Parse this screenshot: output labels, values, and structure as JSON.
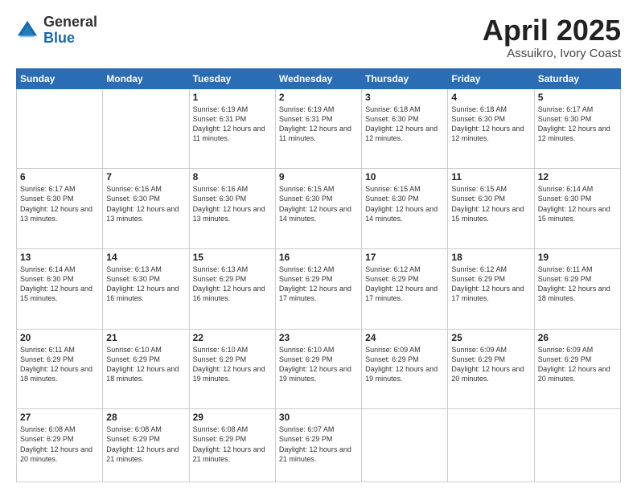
{
  "header": {
    "logo_general": "General",
    "logo_blue": "Blue",
    "title": "April 2025",
    "location": "Assuikro, Ivory Coast"
  },
  "weekdays": [
    "Sunday",
    "Monday",
    "Tuesday",
    "Wednesday",
    "Thursday",
    "Friday",
    "Saturday"
  ],
  "weeks": [
    [
      {
        "day": "",
        "info": ""
      },
      {
        "day": "",
        "info": ""
      },
      {
        "day": "1",
        "info": "Sunrise: 6:19 AM\nSunset: 6:31 PM\nDaylight: 12 hours and 11 minutes."
      },
      {
        "day": "2",
        "info": "Sunrise: 6:19 AM\nSunset: 6:31 PM\nDaylight: 12 hours and 11 minutes."
      },
      {
        "day": "3",
        "info": "Sunrise: 6:18 AM\nSunset: 6:30 PM\nDaylight: 12 hours and 12 minutes."
      },
      {
        "day": "4",
        "info": "Sunrise: 6:18 AM\nSunset: 6:30 PM\nDaylight: 12 hours and 12 minutes."
      },
      {
        "day": "5",
        "info": "Sunrise: 6:17 AM\nSunset: 6:30 PM\nDaylight: 12 hours and 12 minutes."
      }
    ],
    [
      {
        "day": "6",
        "info": "Sunrise: 6:17 AM\nSunset: 6:30 PM\nDaylight: 12 hours and 13 minutes."
      },
      {
        "day": "7",
        "info": "Sunrise: 6:16 AM\nSunset: 6:30 PM\nDaylight: 12 hours and 13 minutes."
      },
      {
        "day": "8",
        "info": "Sunrise: 6:16 AM\nSunset: 6:30 PM\nDaylight: 12 hours and 13 minutes."
      },
      {
        "day": "9",
        "info": "Sunrise: 6:15 AM\nSunset: 6:30 PM\nDaylight: 12 hours and 14 minutes."
      },
      {
        "day": "10",
        "info": "Sunrise: 6:15 AM\nSunset: 6:30 PM\nDaylight: 12 hours and 14 minutes."
      },
      {
        "day": "11",
        "info": "Sunrise: 6:15 AM\nSunset: 6:30 PM\nDaylight: 12 hours and 15 minutes."
      },
      {
        "day": "12",
        "info": "Sunrise: 6:14 AM\nSunset: 6:30 PM\nDaylight: 12 hours and 15 minutes."
      }
    ],
    [
      {
        "day": "13",
        "info": "Sunrise: 6:14 AM\nSunset: 6:30 PM\nDaylight: 12 hours and 15 minutes."
      },
      {
        "day": "14",
        "info": "Sunrise: 6:13 AM\nSunset: 6:30 PM\nDaylight: 12 hours and 16 minutes."
      },
      {
        "day": "15",
        "info": "Sunrise: 6:13 AM\nSunset: 6:29 PM\nDaylight: 12 hours and 16 minutes."
      },
      {
        "day": "16",
        "info": "Sunrise: 6:12 AM\nSunset: 6:29 PM\nDaylight: 12 hours and 17 minutes."
      },
      {
        "day": "17",
        "info": "Sunrise: 6:12 AM\nSunset: 6:29 PM\nDaylight: 12 hours and 17 minutes."
      },
      {
        "day": "18",
        "info": "Sunrise: 6:12 AM\nSunset: 6:29 PM\nDaylight: 12 hours and 17 minutes."
      },
      {
        "day": "19",
        "info": "Sunrise: 6:11 AM\nSunset: 6:29 PM\nDaylight: 12 hours and 18 minutes."
      }
    ],
    [
      {
        "day": "20",
        "info": "Sunrise: 6:11 AM\nSunset: 6:29 PM\nDaylight: 12 hours and 18 minutes."
      },
      {
        "day": "21",
        "info": "Sunrise: 6:10 AM\nSunset: 6:29 PM\nDaylight: 12 hours and 18 minutes."
      },
      {
        "day": "22",
        "info": "Sunrise: 6:10 AM\nSunset: 6:29 PM\nDaylight: 12 hours and 19 minutes."
      },
      {
        "day": "23",
        "info": "Sunrise: 6:10 AM\nSunset: 6:29 PM\nDaylight: 12 hours and 19 minutes."
      },
      {
        "day": "24",
        "info": "Sunrise: 6:09 AM\nSunset: 6:29 PM\nDaylight: 12 hours and 19 minutes."
      },
      {
        "day": "25",
        "info": "Sunrise: 6:09 AM\nSunset: 6:29 PM\nDaylight: 12 hours and 20 minutes."
      },
      {
        "day": "26",
        "info": "Sunrise: 6:09 AM\nSunset: 6:29 PM\nDaylight: 12 hours and 20 minutes."
      }
    ],
    [
      {
        "day": "27",
        "info": "Sunrise: 6:08 AM\nSunset: 6:29 PM\nDaylight: 12 hours and 20 minutes."
      },
      {
        "day": "28",
        "info": "Sunrise: 6:08 AM\nSunset: 6:29 PM\nDaylight: 12 hours and 21 minutes."
      },
      {
        "day": "29",
        "info": "Sunrise: 6:08 AM\nSunset: 6:29 PM\nDaylight: 12 hours and 21 minutes."
      },
      {
        "day": "30",
        "info": "Sunrise: 6:07 AM\nSunset: 6:29 PM\nDaylight: 12 hours and 21 minutes."
      },
      {
        "day": "",
        "info": ""
      },
      {
        "day": "",
        "info": ""
      },
      {
        "day": "",
        "info": ""
      }
    ]
  ]
}
